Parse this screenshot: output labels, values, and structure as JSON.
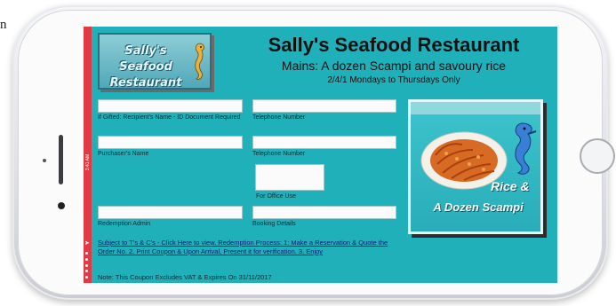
{
  "page_edge_text": "n",
  "restaurant": {
    "logo_line1": "Sally's Seafood",
    "logo_line2": "Restaurant",
    "title": "Sally's Seafood Restaurant",
    "subtitle": "Mains: A dozen Scampi and savoury rice",
    "availability": "2/4/1 Mondays to Thursdays Only"
  },
  "status_bar": {
    "time": "3:41 AM"
  },
  "form": {
    "recipient_label": "If Gifted: Recipient's Name - ID Document Required",
    "telephone_label_1": "Telephone Number",
    "purchaser_label": "Purchaser's Name",
    "telephone_label_2": "Telephone Number",
    "office_use_label": "For Office Use",
    "redemption_admin_label": "Redemption Admin",
    "booking_details_label": "Booking Details"
  },
  "terms_link": "Subject to T's & C's - Click Here to view. Redemption Process: 1: Make a Reservation & Quote the Order No. 2. Print Coupon & Upon Arrival, Present it for verification. 3. Enjoy",
  "note": "Note: This Coupon Excludes VAT & Expires On 31/11/2017",
  "promo": {
    "caption_line1": "Rice &",
    "caption_line2": "A Dozen Scampi"
  },
  "colors": {
    "screen_bg": "#1fb0ba",
    "status_strip": "#e23a44",
    "link": "#0b1f7a"
  },
  "icons": [
    "seahorse-icon",
    "scampi-plate-image",
    "home-button"
  ]
}
